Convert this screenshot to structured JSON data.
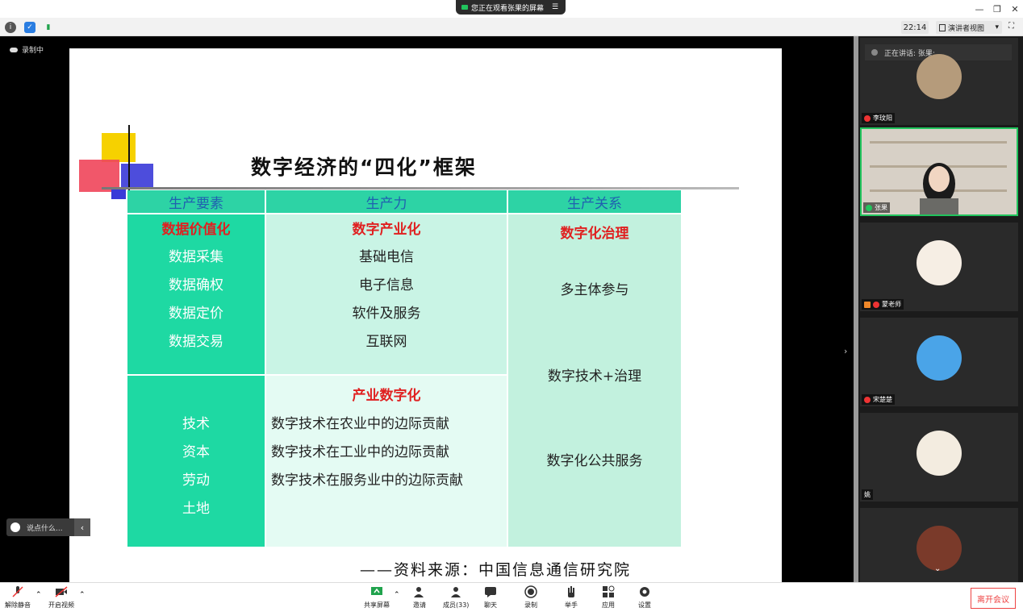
{
  "titlebar": {
    "share_notice": "您正在观看张果的屏幕",
    "menu_icon": "menu-icon"
  },
  "toolbar": {
    "clock": "22:14",
    "view_mode": "演讲者视图"
  },
  "stage": {
    "recording_label": "录制中",
    "chat_placeholder": "说点什么..."
  },
  "slide": {
    "title": "数字经济的“四化”框架",
    "headers": [
      "生产要素",
      "生产力",
      "生产关系"
    ],
    "col1_top_title": "数据价值化",
    "col1_top_items": [
      "数据采集",
      "数据确权",
      "数据定价",
      "数据交易"
    ],
    "col1_bottom_items": [
      "技术",
      "资本",
      "劳动",
      "土地"
    ],
    "col2_top_title": "数字产业化",
    "col2_top_items": [
      "基础电信",
      "电子信息",
      "软件及服务",
      "互联网"
    ],
    "col2_bottom_title": "产业数字化",
    "col2_bottom_items": [
      "数字技术在农业中的边际贡献",
      "数字技术在工业中的边际贡献",
      "数字技术在服务业中的边际贡献"
    ],
    "col3_title": "数字化治理",
    "col3_items": [
      "多主体参与",
      "数字技术+治理",
      "数字化公共服务"
    ],
    "source": "——资料来源：中国信息通信研究院"
  },
  "sidepanel": {
    "speaking_now": "正在讲话: 张果;",
    "participants": [
      "李玟阳",
      "张果",
      "蒙老师",
      "宋楚楚",
      "姚",
      ""
    ]
  },
  "bottombar": {
    "unmute": "解除静音",
    "start_video": "开启视频",
    "share_screen": "共享屏幕",
    "invite": "邀请",
    "members": "成员(33)",
    "chat": "聊天",
    "record": "录制",
    "raise_hand": "举手",
    "apps": "应用",
    "settings": "设置",
    "leave": "离开会议"
  },
  "colors": {
    "accent_green": "#2dd3a5",
    "table_red": "#e02020",
    "header_blue": "#2060b0",
    "leave_red": "#e44444"
  }
}
